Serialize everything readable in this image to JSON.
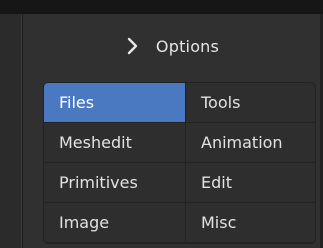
{
  "header": {
    "label": "Options",
    "icon": "chevron-right-icon"
  },
  "colors": {
    "panel_bg": "#303030",
    "cell_bg": "#2e2e2e",
    "active_bg": "#4a79c1",
    "text": "#e2e2e2"
  },
  "tabs": [
    {
      "label": "Files",
      "active": true
    },
    {
      "label": "Tools",
      "active": false
    },
    {
      "label": "Meshedit",
      "active": false
    },
    {
      "label": "Animation",
      "active": false
    },
    {
      "label": "Primitives",
      "active": false
    },
    {
      "label": "Edit",
      "active": false
    },
    {
      "label": "Image",
      "active": false
    },
    {
      "label": "Misc",
      "active": false
    }
  ]
}
